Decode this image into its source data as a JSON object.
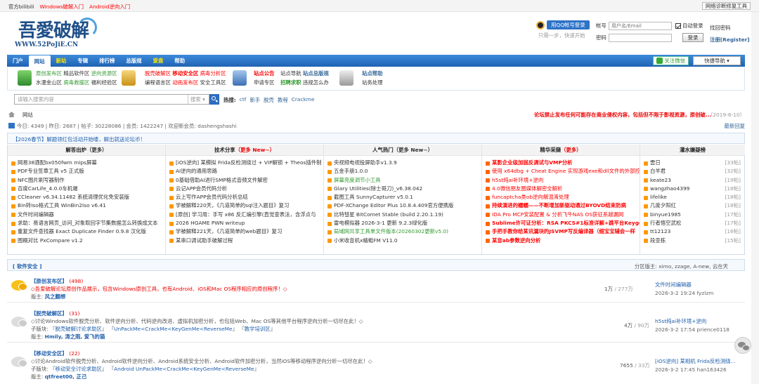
{
  "topbar": {
    "site": "官方bilibili",
    "link1": "Windows破解入门",
    "link2": "Android逆向入门",
    "notice_tool": "网络诊断修复工具"
  },
  "logo": {
    "main": "吾愛破解",
    "url": "WWW.52PoJiE.CN"
  },
  "qq": {
    "button": "用QQ帐号登录",
    "sub": "只需一步，快速开始"
  },
  "login": {
    "user_label": "帐号",
    "user_placeholder": "用户名/Email",
    "auto": "自动登录",
    "forgot": "找回密码",
    "pass_label": "密码",
    "submit": "登录",
    "register": "注册[Register]"
  },
  "nav": {
    "items": [
      "门户",
      "网站",
      "新站",
      "专辑",
      "排行榜",
      "总版规",
      "爱盘",
      "帮助"
    ],
    "follow": "关注微信",
    "quicknav": "快捷导航 ▾"
  },
  "subnav": {
    "g1": {
      "a": "原创发布区",
      "b": "精品软件区",
      "c": "逆向资源区",
      "d": "水漫金山区",
      "e": "病毒救援区",
      "f": "福利经验区"
    },
    "g2": {
      "a": "脱壳破解区",
      "b": "移动安全区",
      "c": "病毒分析区",
      "d": "编程语言区",
      "e": "动画发布区",
      "f": "安全工具区"
    },
    "g3": {
      "a": "站点公告",
      "b": "站点导航",
      "c": "站点总版规",
      "d": "申请专区",
      "e": "招聘求职",
      "f": "违规怎么办"
    },
    "g4": {
      "a": "站点帮助",
      "b": "站务处理"
    }
  },
  "search": {
    "placeholder": "请输入搜索内容",
    "select": "搜索 ▾",
    "hot_label": "热搜:",
    "hot": [
      "ctf",
      "新手",
      "脱壳",
      "教程",
      "Crackme"
    ]
  },
  "crumb": {
    "text": "网站",
    "notice": "论坛禁止发布任何可能存在商业侵权内容，包括但不限于影视资源，原创破...",
    "date": "（2019-6-10）"
  },
  "stats": {
    "text": "今日: 4349 | 昨日: 2687 | 帖子: 30228086 | 会员: 1422247 | 欢迎新会员: dashengshashi",
    "latest": "最新回复"
  },
  "announce": "【2026春节】解题领红包活动开始喽，解出就送论坛币！",
  "columns": [
    {
      "head": "解答出炉",
      "more": "（更多）",
      "items": [
        "网易38酒配bx050fwm mips屏幕",
        "PDF专业签章工具 v5 正式版",
        "NFC图片刷写器制作",
        "百度CarLife_4.0.0车机端",
        "CCleaner v6.34.11482 系统清理优化免安装版",
        "Bin转Iso格式工具 WinBin2Iso v6.41",
        "文件时间编辑器",
        "求助：易语言网页_访问_对象取回字节集数据怎么转换成文本",
        "重复文件查找器 Exact Duplicate Finder 0.9.8 汉化版",
        "图概对比 PxCompare v1.2"
      ]
    },
    {
      "head": "技术分享",
      "more": "（更多 New~）",
      "items": [
        "[iOS逆向] 某模拟 Frida反检测绕过 + VIP解锁 + Theos插件制",
        "AI逆向的通用思路",
        "0基础借助AI进行SMP格式音频文件解密",
        "云记APP会员代码分析",
        "云上写作APP会员代码分析总结",
        "学被解释220天，《几道简单的sql注入题目》复习",
        "[原创] 学习用：手写 x86 反汇编引擎(直觉查表法，含浮点与",
        "2026 HGAME PWN writeup",
        "学被解释221天，《几道简单的web题目》复习",
        "某串口调试助手破解过程"
      ]
    },
    {
      "head": "人气热门",
      "more": "（更多 New~）",
      "items": [
        "央视频电视投屏助手v1.3.9",
        "五金手册1.0.0",
        "屏幕亮度调节小工具",
        "Glary Utilities(除士哥刀)_v6.38.042",
        "截图工具 SunnyCapturer v5.0.1",
        "PDF-XChange Editor Plus 10.8.4.409官方便携版",
        "比特彗星 BitComet Stable (build 2.20.1.19)",
        "雷电模拟器 2026-3-1 更新 9.2.3绿化版",
        "局域网共享工具单文件版本(20260302更新v5.0)",
        "小米收音机x蜻蜓FM V11.0"
      ]
    },
    {
      "head": "精华采撷",
      "more": "（更多）",
      "items": [
        "某影企业级加固反调试与VMP分析",
        "使用 x64dbg + Cheat Engine 实现游戏exe和dll文件的外部控",
        "h5st纯ai补环境+逆向",
        "4.0微信朋友圈媒体解密全解析",
        "funcaptcha类ob逆向解混淆处理",
        "持续演进的蠕蠕——不断增加新驱动通过BYOVD结束防病",
        "IDA Pro MCP安装配置 & 分析飞牛NAS OS获征系越漏网",
        "Sublime许可证分析：RSA PKCS#1标准详解+跳平台Keygen",
        "手把手教你给某讯漏块的JSVMP写反编译器（细宝宝辅会一样",
        "某音ab参数逆向分析"
      ]
    },
    {
      "head": "灌水嫌疑榜",
      "more": "",
      "items": [
        {
          "n": "雲日",
          "c": "[33帖]"
        },
        {
          "n": "白羊君",
          "c": "[32帖]"
        },
        {
          "n": "keate23",
          "c": "[19帖]"
        },
        {
          "n": "wangzhao4399",
          "c": "[18帖]"
        },
        {
          "n": "lifelike",
          "c": "[18帖]"
        },
        {
          "n": "几度夕阳红",
          "c": "[18帖]"
        },
        {
          "n": "binyue1985",
          "c": "[17帖]"
        },
        {
          "n": "行者悟空武松",
          "c": "[17帖]"
        },
        {
          "n": "tt12123",
          "c": "[16帖]"
        },
        {
          "n": "段亚栋",
          "c": "[15帖]"
        }
      ]
    }
  ],
  "section": {
    "title": "软件安全",
    "mods": "分区版主: ximo, zzage, A-new, 云在天"
  },
  "forums": [
    {
      "name": "原创发布区",
      "count": "(498)",
      "desc": "◇吾爱破解论坛原创作品展示，包含Windows原创工具，也有Android、iOS和Mac OS程序相应的原创程序！◇",
      "sub_label": "",
      "subs": [],
      "mod_label": "版主:",
      "mods": "风之翻想",
      "nums": "1万",
      "total": "/ 277万",
      "last_title": "文件时间编辑器",
      "last_info": "2026-3-2 19:24 fyzlzm"
    },
    {
      "name": "脱壳破解区",
      "count": "(31)",
      "desc": "◇讨论Windows软件脱壳分析、软件逆向分析、代码逆向改进、虚拟机加密分析，也包括Web、Mac OS等其他平台程序逆向分析一切尽在此！◇",
      "sub_label": "子版块:",
      "subs": [
        "脱壳破解讨论求助区",
        "UnPackMe<CrackMe<KeyGenMe<ReverseMe",
        "教学培训区"
      ],
      "mod_label": "版主:",
      "mods": "Hmily, 涛之雨, 爱飞的猫",
      "nums": "4万",
      "total": "/ 90万",
      "last_title": "h5st纯ai补环境+逆向",
      "last_info": "2026-3-2 17:54 prience0118"
    },
    {
      "name": "移动安全区",
      "count": "(22)",
      "desc": "◇讨论Android软件脱壳分析、Android软件逆向分析、Android系统安全分析、Android软件加密分析，当然iOS等移动程序逆向分析一切尽在此！◇",
      "sub_label": "子版块:",
      "subs": [
        "移动安全讨论求助区",
        "Android UnPackMe<CrackMe<KeyGenMe<ReverseMe"
      ],
      "mod_label": "版主:",
      "mods": "qtfreet00, 正己",
      "nums": "7655",
      "total": "/ 33万",
      "last_title": "[iOS逆向] 某相机 Frida反检测绕...",
      "last_info": "2026-3-2 17:45 han163426"
    }
  ]
}
